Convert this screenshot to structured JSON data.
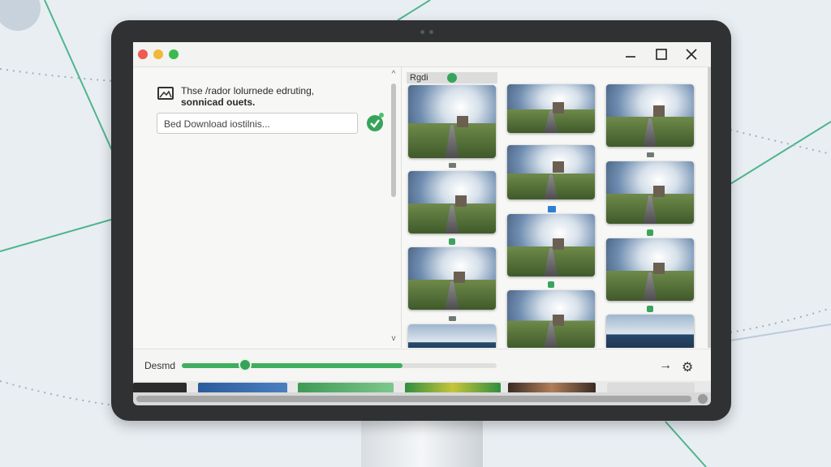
{
  "window": {
    "controls": {
      "close_color": "#ef5b52",
      "minimize_color": "#f2b83a",
      "maximize_color": "#3dba4e"
    },
    "buttons": [
      "minimize-icon",
      "maximize-icon",
      "close-icon"
    ]
  },
  "left_panel": {
    "description_line1": "Thse /rador lolurnede edruting,",
    "description_line2": "sonnicad ouets.",
    "search_placeholder": "Bed Download iostilnis...",
    "confirm_icon": "check-circle-icon"
  },
  "gallery": {
    "header_label": "Rgdi",
    "accent": "#36a35b",
    "columns": [
      {
        "items": [
          "road-photo",
          "road-photo",
          "road-photo",
          "road-photo"
        ]
      },
      {
        "items": [
          "road-photo",
          "road-photo",
          "road-photo",
          "road-photo"
        ]
      },
      {
        "items": [
          "road-photo",
          "road-photo",
          "road-photo",
          "lake-photo"
        ]
      }
    ]
  },
  "bottom_bar": {
    "label": "Desmd",
    "progress": 0.7,
    "handle_position": 0.2,
    "next_icon": "arrow-right-icon",
    "settings_icon": "gear-icon"
  }
}
